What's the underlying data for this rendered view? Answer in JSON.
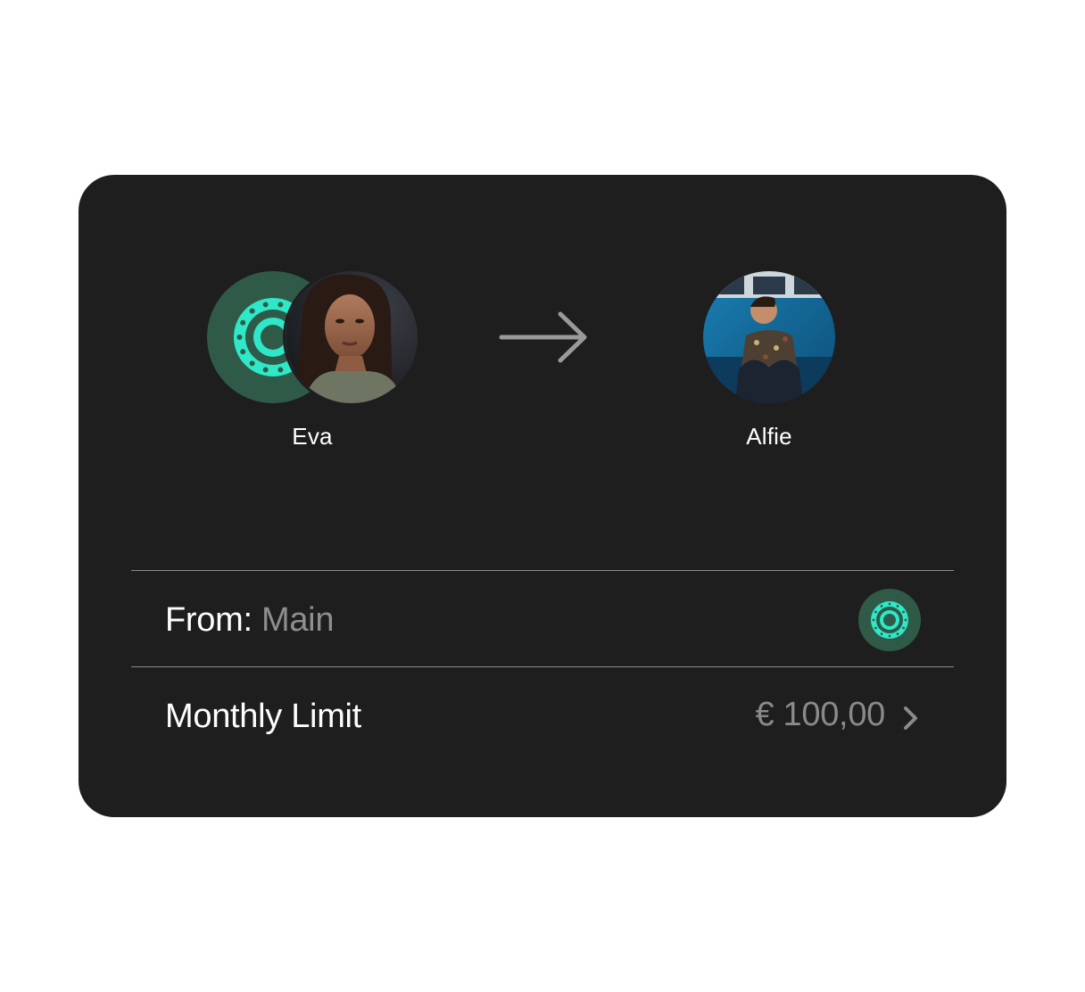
{
  "sender": {
    "name": "Eva"
  },
  "recipient": {
    "name": "Alfie"
  },
  "from_row": {
    "label": "From:",
    "value": "Main"
  },
  "limit_row": {
    "label": "Monthly Limit",
    "value": "€ 100,00"
  },
  "icons": {
    "transfer": "arrow-right-icon",
    "account": "account-icon",
    "navigate": "chevron-right-icon"
  },
  "colors": {
    "card_background": "#1e1e1e",
    "accent": "#2ee8c8",
    "account_circle": "#2f5a47",
    "muted_text": "#8e8e8e"
  }
}
